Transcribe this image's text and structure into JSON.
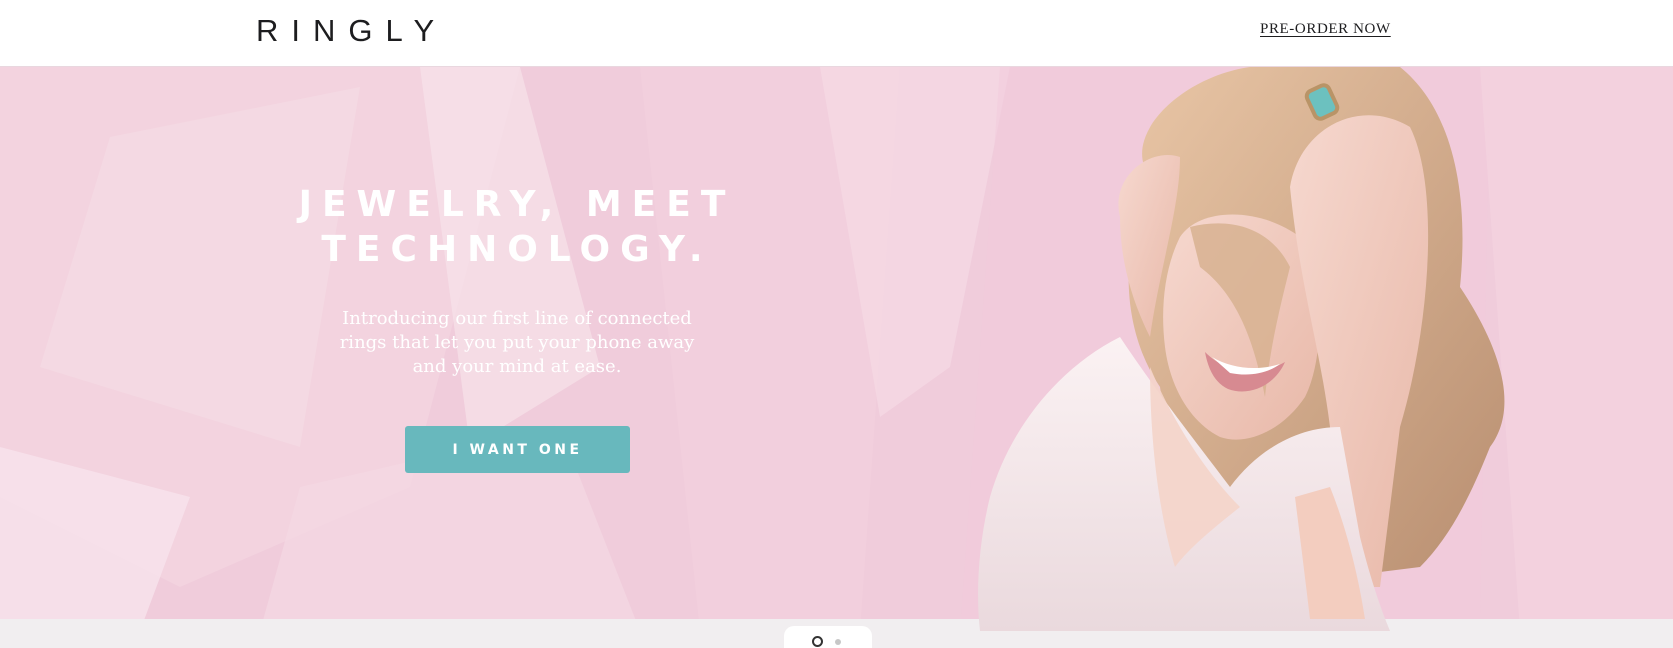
{
  "header": {
    "logo_text": "RINGLY",
    "preorder_link": "PRE-ORDER NOW"
  },
  "hero": {
    "headline_line1": "JEWELRY, MEET",
    "headline_line2": "TECHNOLOGY.",
    "subtitle_line1": "Introducing our first line of connected",
    "subtitle_line2": "rings that let you put your phone away",
    "subtitle_line3": "and your mind at ease.",
    "cta_label": "I WANT ONE"
  },
  "carousel": {
    "slide_count": 2,
    "active_slide": 1
  },
  "colors": {
    "accent": "#68b8bd",
    "hero_background": "#f0ccdb",
    "text_dark": "#1d1d1f"
  }
}
